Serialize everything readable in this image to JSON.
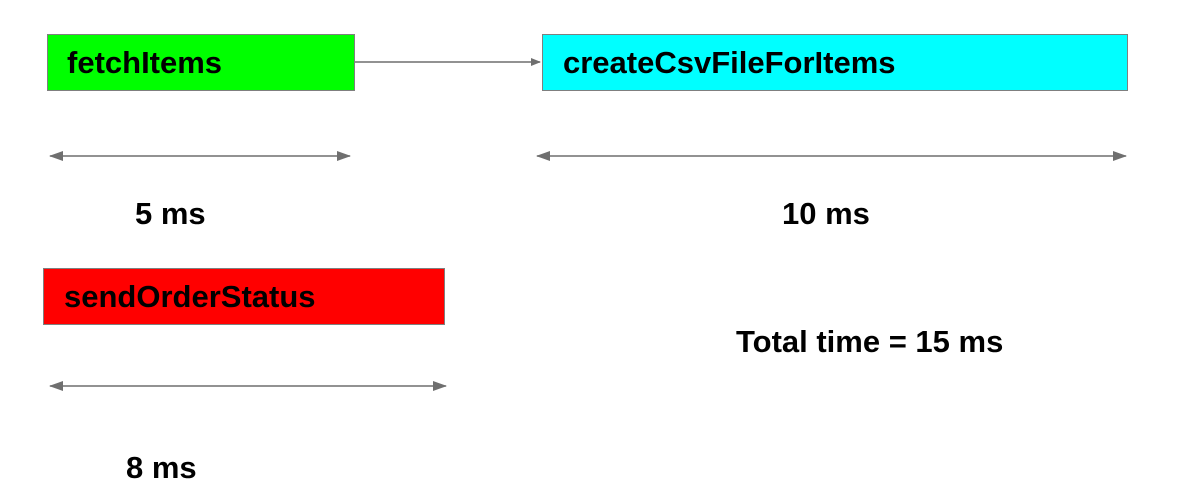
{
  "tasks": [
    {
      "name": "fetchItems",
      "color": "#00ff00",
      "duration": "5 ms"
    },
    {
      "name": "createCsvFileForItems",
      "color": "#00ffff",
      "duration": "10 ms"
    },
    {
      "name": "sendOrderStatus",
      "color": "#ff0000",
      "duration": "8 ms"
    }
  ],
  "summary": {
    "total": "Total time = 15 ms"
  },
  "colors": {
    "arrow": "#6f6f6f",
    "box_border": "#7f7f7f"
  }
}
